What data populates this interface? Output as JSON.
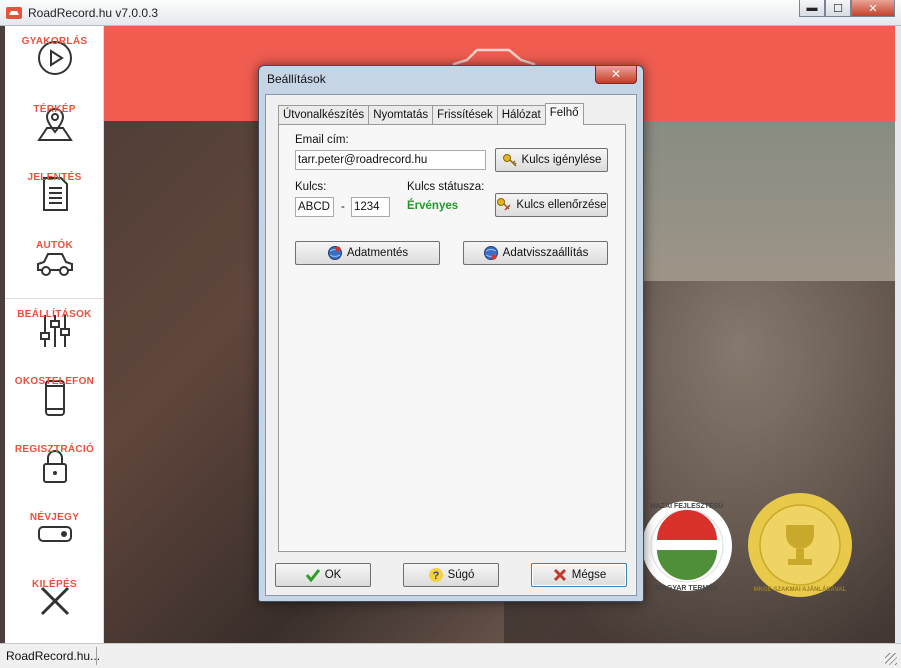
{
  "window": {
    "title": "RoadRecord.hu v7.0.0.3",
    "minimize": "▬",
    "maximize": "☐",
    "close": "✕"
  },
  "sidebar": {
    "items": [
      {
        "label": "GYAKORLÁS",
        "icon": "play-icon"
      },
      {
        "label": "TÉRKÉP",
        "icon": "map-icon"
      },
      {
        "label": "JELENTÉS",
        "icon": "document-icon"
      },
      {
        "label": "AUTÓK",
        "icon": "car-icon"
      },
      {
        "label": "BEÁLLÍTÁSOK",
        "icon": "sliders-icon"
      },
      {
        "label": "OKOSTELEFON",
        "icon": "smartphone-icon"
      },
      {
        "label": "REGISZTRÁCIÓ",
        "icon": "lock-icon"
      },
      {
        "label": "NÉVJEGY",
        "icon": "tag-icon"
      },
      {
        "label": "KILÉPÉS",
        "icon": "x-icon"
      }
    ]
  },
  "dialog": {
    "title": "Beállítások",
    "close": "✕",
    "tabs": [
      "Útvonalkészítés",
      "Nyomtatás",
      "Frissítések",
      "Hálózat",
      "Felhő"
    ],
    "active_tab": "Felhő",
    "email_label": "Email cím:",
    "email_value": "tarr.peter@roadrecord.hu",
    "request_key_button": "Kulcs igénylése",
    "key_label": "Kulcs:",
    "key_part1": "ABCD",
    "key_separator": "-",
    "key_part2": "1234",
    "key_status_label": "Kulcs státusza:",
    "key_status_value": "Érvényes",
    "verify_key_button": "Kulcs ellenőrzése",
    "backup_button": "Adatmentés",
    "restore_button": "Adatvisszaállítás",
    "ok_button": "OK",
    "help_button": "Súgó",
    "cancel_button": "Mégse"
  },
  "badges": {
    "badge1_top": "HAZAI FEJLESZTÉSŰ",
    "badge1_bottom": "MAGYAR TERMÉK",
    "badge2_text": "MKOE SZAKMAI AJÁNLÁSÁVAL"
  },
  "statusbar": {
    "text": "RoadRecord.hu..."
  },
  "colors": {
    "accent": "#e8523d",
    "banner": "#f05d50",
    "valid": "#1f9b2a"
  }
}
